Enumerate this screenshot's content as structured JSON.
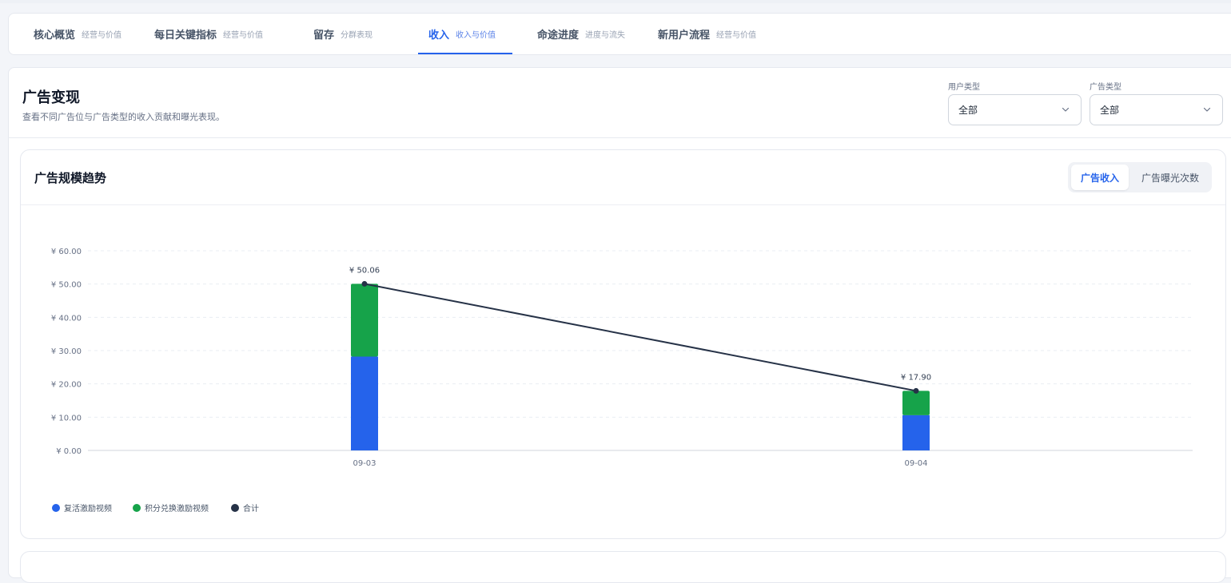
{
  "tabs": [
    {
      "title": "核心概览",
      "sub": "经营与价值"
    },
    {
      "title": "每日关键指标",
      "sub": "经营与价值"
    },
    {
      "title": "留存",
      "sub": "分群表现"
    },
    {
      "title": "收入",
      "sub": "收入与价值"
    },
    {
      "title": "命途进度",
      "sub": "进度与流失"
    },
    {
      "title": "新用户流程",
      "sub": "经营与价值"
    }
  ],
  "active_tab": "收入",
  "section": {
    "title": "广告变现",
    "desc": "查看不同广告位与广告类型的收入贡献和曝光表现。"
  },
  "filters": {
    "user_type_label": "用户类型",
    "user_type_value": "全部",
    "ad_type_label": "广告类型",
    "ad_type_value": "全部"
  },
  "card": {
    "title": "广告规模趋势",
    "seg_revenue": "广告收入",
    "seg_impressions": "广告曝光次数"
  },
  "colors": {
    "accent": "#2563eb",
    "series1": "#2563eb",
    "series2": "#16a34a",
    "total": "#263247"
  },
  "chart_data": {
    "type": "bar",
    "stacked": true,
    "categories": [
      "09-03",
      "09-04"
    ],
    "series": [
      {
        "name": "复活激励视频",
        "values": [
          28.2,
          10.6
        ]
      },
      {
        "name": "积分兑换激励视频",
        "values": [
          21.86,
          7.3
        ]
      }
    ],
    "line": {
      "name": "合计",
      "values": [
        50.06,
        17.9
      ]
    },
    "data_labels": [
      "¥ 50.06",
      "¥ 17.90"
    ],
    "y_ticks": [
      "¥ 0.00",
      "¥ 10.00",
      "¥ 20.00",
      "¥ 30.00",
      "¥ 40.00",
      "¥ 50.00",
      "¥ 60.00"
    ],
    "ylim": [
      0,
      60
    ],
    "grid": true,
    "legend_position": "bottom-left"
  }
}
